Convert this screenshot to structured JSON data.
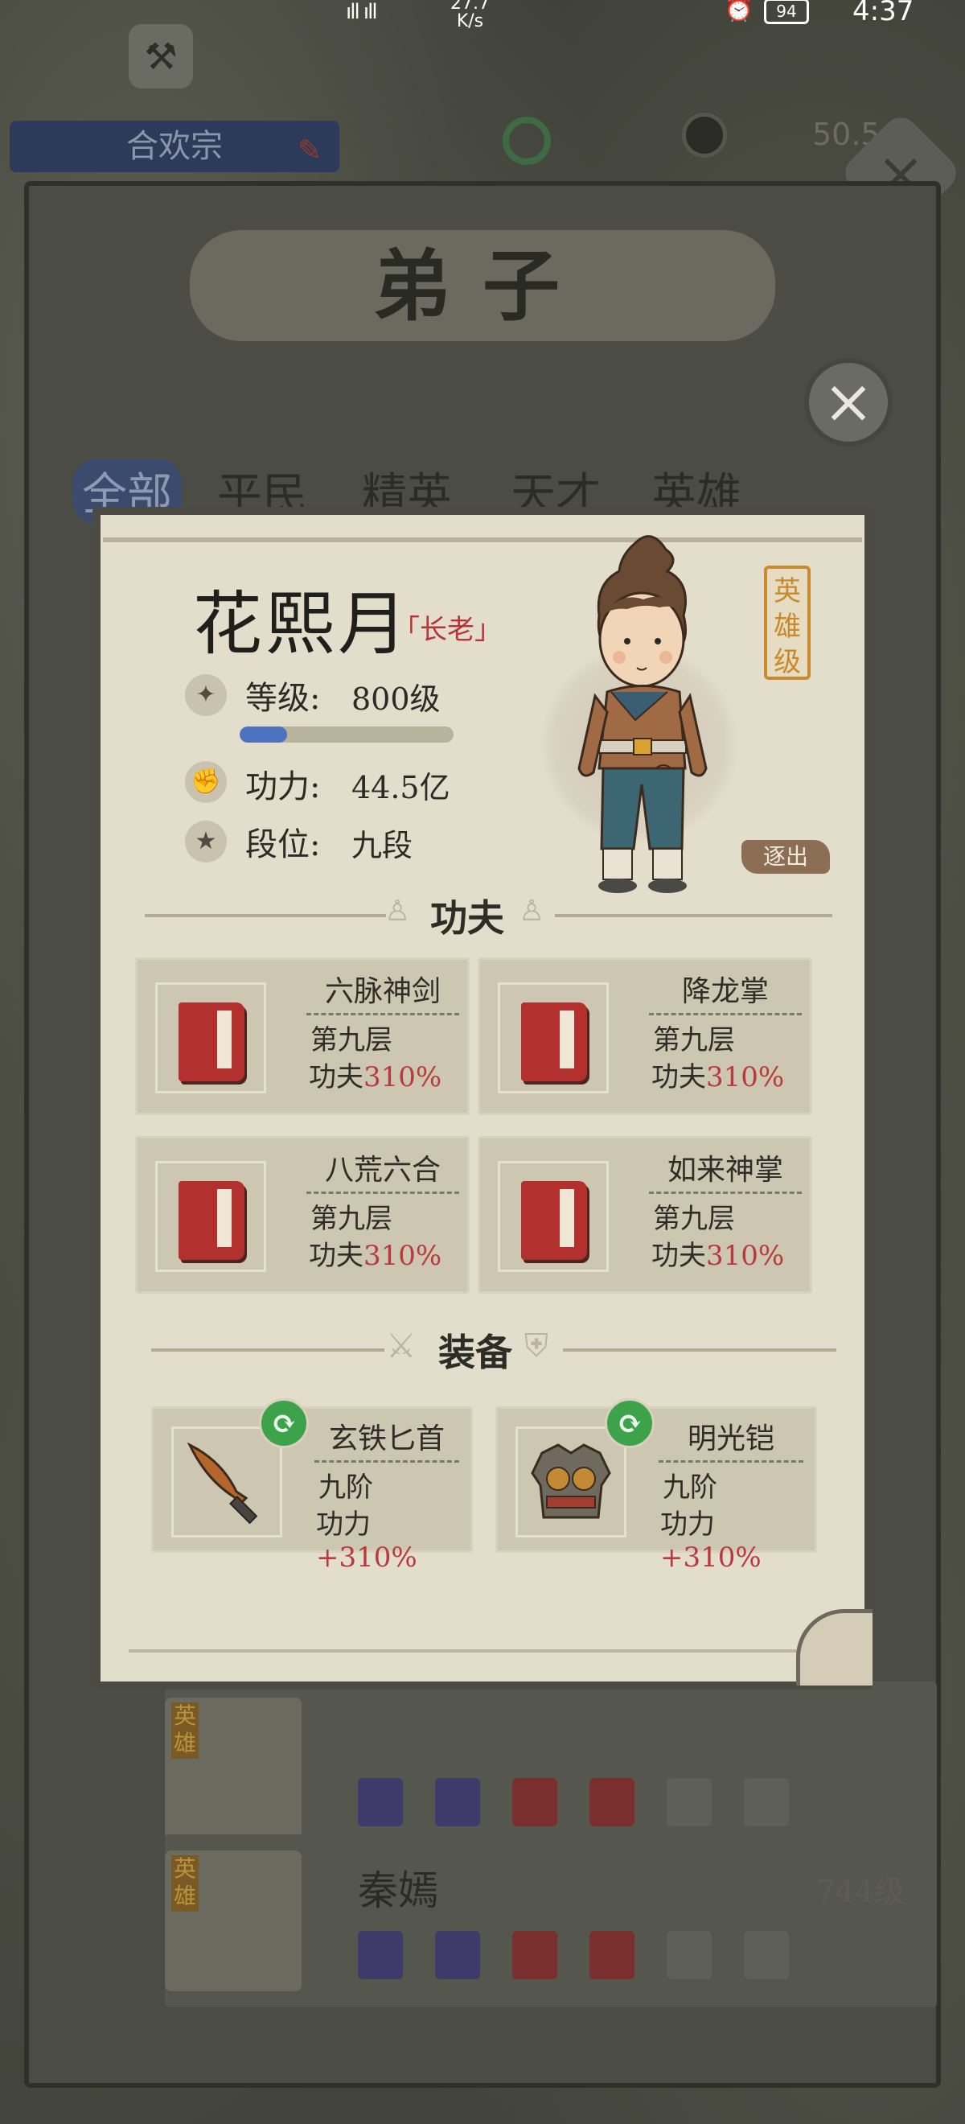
{
  "status_bar": {
    "signal": "ıll ıll",
    "net_speed": "27.7",
    "net_unit": "K/s",
    "battery": "94",
    "time": "4:37"
  },
  "background": {
    "sect_name": "合欢宗",
    "resource_value": "50.5",
    "panel_title": "弟子",
    "tabs": [
      "全部",
      "平民",
      "精英",
      "天才",
      "英雄"
    ],
    "list": [
      {
        "badge": "英雄",
        "name": "",
        "level": ""
      },
      {
        "badge": "英雄",
        "name": "秦嫣",
        "level": "744级"
      }
    ]
  },
  "disciple": {
    "name": "花熙月",
    "title": "长老",
    "rank_tag": "英雄级",
    "level_label": "等级:",
    "level_value": "800级",
    "level_progress": 0.22,
    "power_label": "功力:",
    "power_value": "44.5亿",
    "grade_label": "段位:",
    "grade_value": "九段",
    "expel_label": "逐出"
  },
  "kungfu": {
    "heading": "功夫",
    "skills": [
      {
        "name": "六脉神剑",
        "layer": "第九层",
        "power_label": "功夫",
        "power_pct": "310%"
      },
      {
        "name": "降龙掌",
        "layer": "第九层",
        "power_label": "功夫",
        "power_pct": "310%"
      },
      {
        "name": "八荒六合",
        "layer": "第九层",
        "power_label": "功夫",
        "power_pct": "310%"
      },
      {
        "name": "如来神掌",
        "layer": "第九层",
        "power_label": "功夫",
        "power_pct": "310%"
      }
    ]
  },
  "equipment": {
    "heading": "装备",
    "items": [
      {
        "name": "玄铁匕首",
        "tier": "九阶",
        "power_label": "功力",
        "power_pct": "+310%",
        "icon": "dagger-icon"
      },
      {
        "name": "明光铠",
        "tier": "九阶",
        "power_label": "功力",
        "power_pct": "+310%",
        "icon": "armor-icon"
      }
    ]
  },
  "colors": {
    "accent_red": "#b83a3e",
    "progress_blue": "#4d72c0",
    "swap_green": "#3da34a",
    "rank_gold": "#c88a2c"
  }
}
